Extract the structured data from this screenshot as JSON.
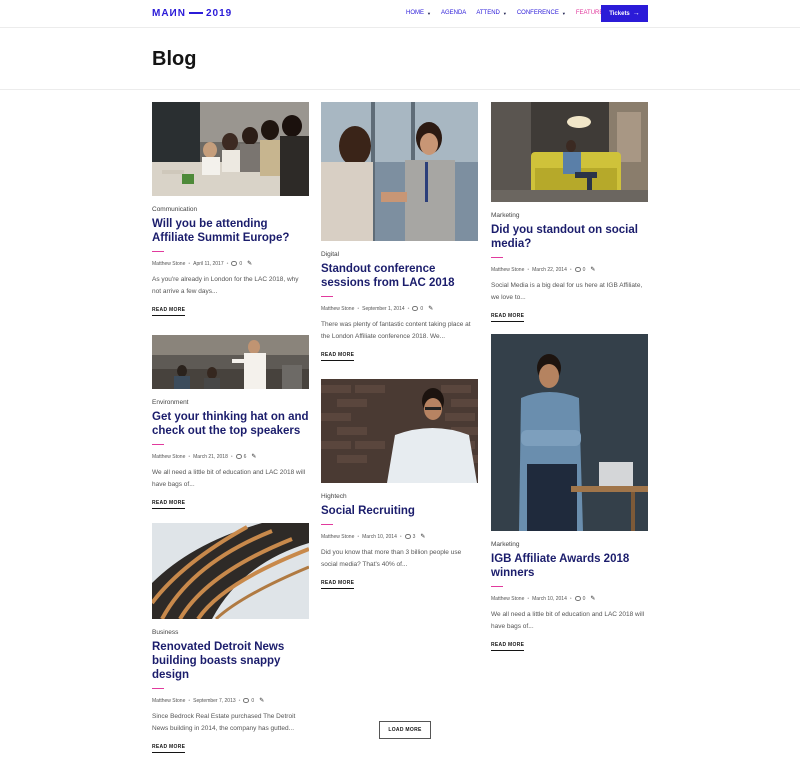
{
  "header": {
    "logo_left": "MAИN",
    "logo_right": "2019",
    "nav": [
      {
        "label": "HOME",
        "caret": true,
        "active": false
      },
      {
        "label": "AGENDA",
        "caret": false,
        "active": false
      },
      {
        "label": "ATTEND",
        "caret": true,
        "active": false
      },
      {
        "label": "CONFERENCE",
        "caret": true,
        "active": false
      },
      {
        "label": "FEATURES",
        "caret": true,
        "active": true
      }
    ],
    "tickets_label": "Tickets",
    "tickets_arrow": "→"
  },
  "page_title": "Blog",
  "colors": {
    "accent": "#2b1bd8",
    "highlight": "#e13a9d",
    "title": "#1b1d6c"
  },
  "posts": {
    "p1": {
      "category": "Communication",
      "title": "Will you be attending Affiliate Summit Europe?",
      "author": "Matthew Stone",
      "date": "April 11, 2017",
      "comments": "0",
      "excerpt": "As you're already in London for the LAC 2018, why not arrive a few days...",
      "read_more": "READ MORE"
    },
    "p2": {
      "category": "Environment",
      "title": "Get your thinking hat on and check out the top speakers",
      "author": "Matthew Stone",
      "date": "March 21, 2018",
      "comments": "6",
      "excerpt": "We all need a little bit of education and LAC 2018 will have bags of...",
      "read_more": "READ MORE"
    },
    "p3": {
      "category": "Business",
      "title": "Renovated Detroit News building boasts snappy design",
      "author": "Matthew Stone",
      "date": "September 7, 2013",
      "comments": "0",
      "excerpt": "Since Bedrock Real Estate purchased The Detroit News building in 2014, the company has gutted...",
      "read_more": "READ MORE"
    },
    "p4": {
      "category": "Digital",
      "title": "Standout conference sessions from LAC 2018",
      "author": "Matthew Stone",
      "date": "September 1, 2014",
      "comments": "0",
      "excerpt": "There was plenty of fantastic content taking place at the London Affiliate conference 2018. We...",
      "read_more": "READ MORE"
    },
    "p5": {
      "category": "Hightech",
      "title": "Social Recruiting",
      "author": "Matthew Stone",
      "date": "March 10, 2014",
      "comments": "3",
      "excerpt": "Did you know that more than 3 billion people use social media? That's 40% of...",
      "read_more": "READ MORE"
    },
    "p6": {
      "category": "Marketing",
      "title": "Did you standout on social media?",
      "author": "Matthew Stone",
      "date": "March 22, 2014",
      "comments": "0",
      "excerpt": "Social Media is a big deal for us here at IGB Affiliate, we love to...",
      "read_more": "READ MORE"
    },
    "p7": {
      "category": "Marketing",
      "title": "IGB Affiliate Awards 2018 winners",
      "author": "Matthew Stone",
      "date": "March 10, 2014",
      "comments": "0",
      "excerpt": "We all need a little bit of education and LAC 2018 will have bags of...",
      "read_more": "READ MORE"
    }
  },
  "load_more": "LOAD MORE"
}
